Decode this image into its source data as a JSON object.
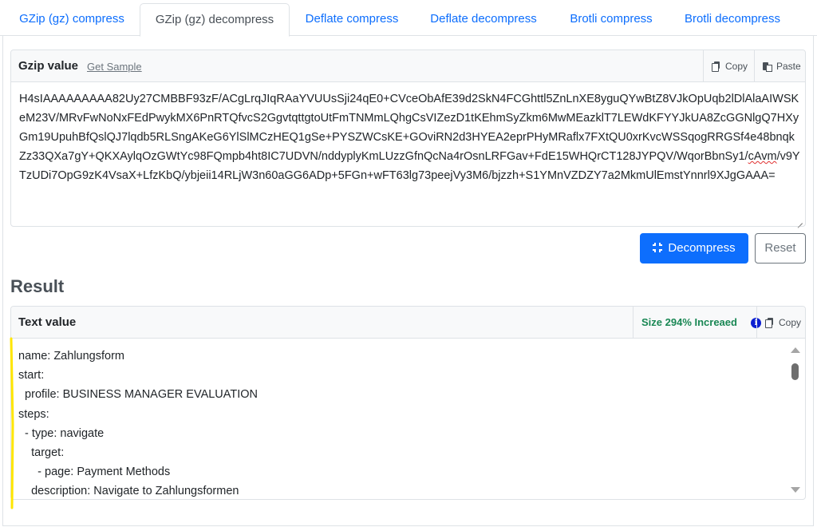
{
  "tabs": [
    {
      "label": "GZip (gz) compress",
      "active": false
    },
    {
      "label": "GZip (gz) decompress",
      "active": true
    },
    {
      "label": "Deflate compress",
      "active": false
    },
    {
      "label": "Deflate decompress",
      "active": false
    },
    {
      "label": "Brotli compress",
      "active": false
    },
    {
      "label": "Brotli decompress",
      "active": false
    }
  ],
  "input_card": {
    "title": "Gzip value",
    "get_sample": "Get Sample",
    "copy_label": "Copy",
    "paste_label": "Paste",
    "value_before_squiggle": "H4sIAAAAAAAAA82Uy27CMBBF93zF/ACgLrqJIqRAaYVUUsSji24qE0+CVceObAfE39d2SkN4FCGhttl5ZnLnXE8yguQYwBtZ8VJkOpUqb2lDlAlaAIWSKeM23V/MRvFwNoNxFEdPwykMX6PnRTQfvcS2GgvtqttgtoUtFmTNMmLQhgCsVIZezD1tKEhmSyZkm6MwMEazklT7LEWdKFYYJkUA8ZcGGNlgQ7HXyGm19UpuhBfQslQJ7lqdb5RLSngAKeG6YlSlMCzHEQ1gSe+PYSZWCsKE+GOviRN2d3HYEA2eprPHyMRaflx7FXtQU0xrKvcWSSqogRRGSf4e48bnqkZz33QXa7gY+QKXAylqOzGWtYc98FQmpb4ht8IC7UDVN/nddyplyKmLUzzGfnQcNa4rOsnLRFGav+FdE15WHQrCT128JYPQV/WqorBbnSy1/",
    "value_squiggle": "cAvm",
    "value_after_squiggle": "/v9YTzUDi7OpG9zK4VsaX+LfzKbQ/ybjeii14RLjW3n60aGG6ADp+5FGn+wFT63lg73peejVy3M6/bjzzh+S1YMnVZDZY7a2MkmUlEmstYnnrl9XJgGAAA="
  },
  "buttons": {
    "decompress": "Decompress",
    "reset": "Reset"
  },
  "result": {
    "heading": "Result",
    "card_title": "Text value",
    "size_info": "Size 294% Increaed",
    "copy_label": "Copy",
    "lines": [
      "name: Zahlungsform",
      "start:",
      "  profile: BUSINESS MANAGER EVALUATION",
      "steps:",
      "  - type: navigate",
      "    target:",
      "      - page: Payment Methods",
      "    description: Navigate to Zahlungsformen"
    ]
  },
  "colors": {
    "link": "#0d6efd",
    "primary": "#0d6efd",
    "success": "#198754",
    "annotation": "#ffe600"
  }
}
